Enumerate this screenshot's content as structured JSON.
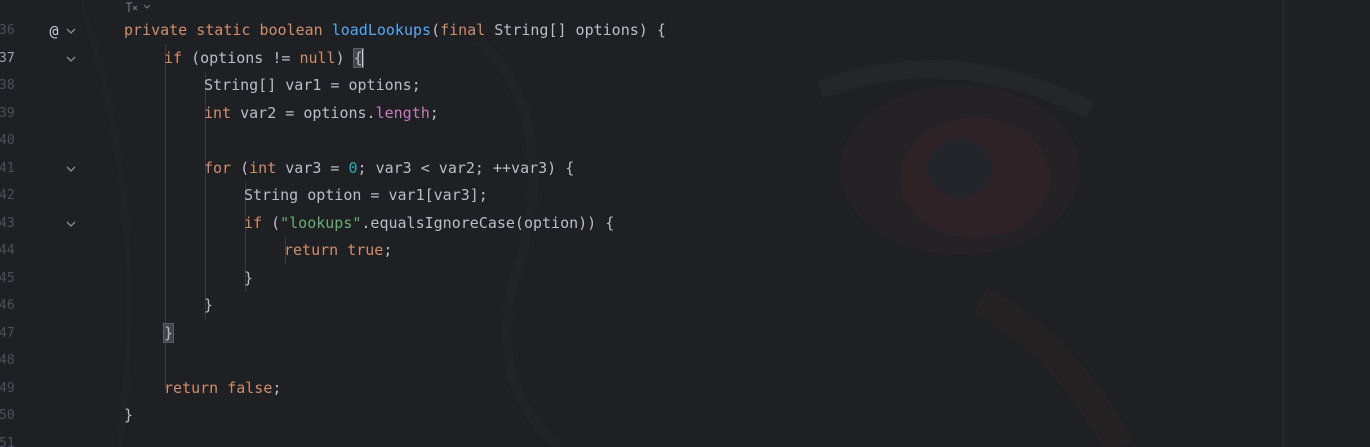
{
  "editor": {
    "gutter": {
      "lines": [
        {
          "number": "36",
          "has_at_icon": true,
          "foldable": true
        },
        {
          "number": "37",
          "current": true,
          "foldable": true
        },
        {
          "number": "38"
        },
        {
          "number": "39"
        },
        {
          "number": "40"
        },
        {
          "number": "41",
          "foldable": true
        },
        {
          "number": "42"
        },
        {
          "number": "43",
          "foldable": true
        },
        {
          "number": "44"
        },
        {
          "number": "45"
        },
        {
          "number": "46"
        },
        {
          "number": "47"
        },
        {
          "number": "48"
        },
        {
          "number": "49"
        },
        {
          "number": "50"
        },
        {
          "number": "51"
        }
      ],
      "at_icon": "@",
      "fold_icon": "chevron-down-icon"
    },
    "code": {
      "l36": {
        "private": "private",
        "static": "static",
        "boolean": "boolean",
        "method": "loadLookups",
        "open": "(",
        "final": "final",
        "rest": " String[] options) {"
      },
      "l37": {
        "if": "if",
        "cond": " (options != ",
        "null": "null",
        "close": ") ",
        "brace": "{"
      },
      "l38": {
        "text": "String[] var1 = options;"
      },
      "l39": {
        "int": "int",
        "mid": " var2 = options.",
        "length": "length",
        "end": ";"
      },
      "l41": {
        "for": "for",
        "open": " (",
        "int": "int",
        "mid": " var3 = ",
        "zero": "0",
        "rest": "; var3 < var2; ++var3) {"
      },
      "l42": {
        "text": "String option = var1[var3];"
      },
      "l43": {
        "if": "if",
        "open": " (",
        "str": "\"lookups\"",
        "rest": ".equalsIgnoreCase(option)) {"
      },
      "l44": {
        "return": "return",
        "true": "true",
        "end": ";"
      },
      "l45": {
        "text": "}"
      },
      "l46": {
        "text": "}"
      },
      "l47": {
        "text": "}"
      },
      "l49": {
        "return": "return",
        "false": "false",
        "end": ";"
      },
      "l50": {
        "text": "}"
      }
    },
    "colors": {
      "background": "#1f2023",
      "keyword": "#cf8e6d",
      "method": "#56a8f5",
      "number": "#2aacb8",
      "string": "#6aab73",
      "field": "#c77dbb",
      "text": "#bcbec4"
    }
  }
}
